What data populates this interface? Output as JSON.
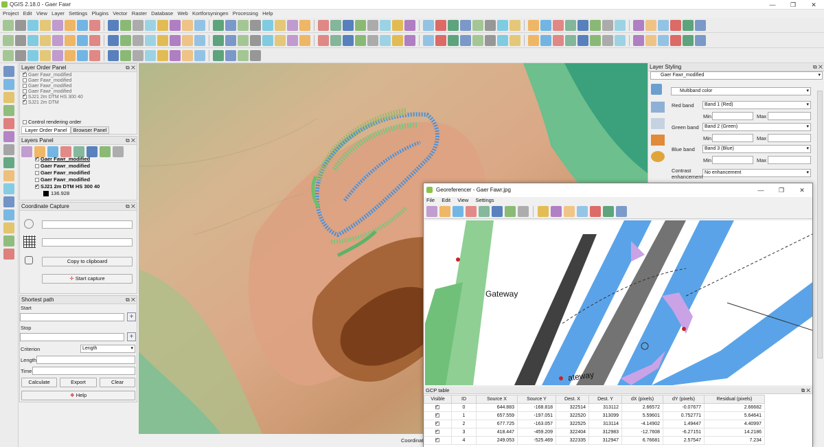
{
  "window": {
    "title": "QGIS 2.18.0 - Gaer Fawr",
    "min": "—",
    "max": "❐",
    "close": "✕"
  },
  "menu": [
    "Project",
    "Edit",
    "View",
    "Layer",
    "Settings",
    "Plugins",
    "Vector",
    "Raster",
    "Database",
    "Web",
    "Kortforsyningen",
    "Processing",
    "Help"
  ],
  "layer_order": {
    "title": "Layer Order Panel",
    "items": [
      "Gaer Fawr_modified",
      "Gaer Fawr_modified",
      "Gaer Fawr_modified",
      "Gaer Fawr_modified",
      "SJ21 2m DTM HS 300 40",
      "SJ21 2m DTM"
    ],
    "control_label": "Control rendering order",
    "tabs": [
      "Layer Order Panel",
      "Browser Panel"
    ]
  },
  "layers": {
    "title": "Layers Panel",
    "items": [
      "Gaer Fawr_modified",
      "Gaer Fawr_modified",
      "Gaer Fawr_modified",
      "Gaer Fawr_modified",
      "SJ21 2m DTM HS 300 40"
    ],
    "value": "136.928"
  },
  "coord_capture": {
    "title": "Coordinate Capture",
    "copy_label": "Copy to clipboard",
    "start_label": "Start capture"
  },
  "shortest_path": {
    "title": "Shortest path",
    "start_label": "Start",
    "stop_label": "Stop",
    "criterion_label": "Criterion",
    "criterion_value": "Length",
    "length_label": "Length",
    "time_label": "Time",
    "calculate": "Calculate",
    "export": "Export",
    "clear": "Clear",
    "help": "Help"
  },
  "layer_styling": {
    "title": "Layer Styling",
    "layer": "Gaer Fawr_modified",
    "renderer": "Multiband color",
    "red_band_label": "Red band",
    "red_band": "Band 1 (Red)",
    "green_band_label": "Green band",
    "green_band": "Band 2 (Green)",
    "blue_band_label": "Blue band",
    "blue_band": "Band 3 (Blue)",
    "min_label": "Min",
    "max_label": "Max",
    "contrast_label": "Contrast enhancement",
    "contrast": "No enhancement"
  },
  "georeferencer": {
    "title": "Georeferencer - Gaer Fawr.jpg",
    "menu": [
      "File",
      "Edit",
      "View",
      "Settings"
    ],
    "map_label_1": "Gateway",
    "map_label_2": "ateway"
  },
  "gcp": {
    "title": "GCP table",
    "headers": [
      "Visible",
      "ID",
      "Source X",
      "Source Y",
      "Dest. X",
      "Dest. Y",
      "dX (pixels)",
      "dY (pixels)",
      "Residual (pixels)"
    ],
    "rows": [
      [
        "0",
        "644.883",
        "-168.818",
        "322514",
        "313112",
        "2.66572",
        "-0.07677",
        "2.66682"
      ],
      [
        "1",
        "657.559",
        "-197.051",
        "322520",
        "313099",
        "5.59601",
        "0.752771",
        "5.64641"
      ],
      [
        "2",
        "677.725",
        "-163.057",
        "322525",
        "313114",
        "-4.14902",
        "1.49447",
        "4.40997"
      ],
      [
        "3",
        "418.447",
        "-459.209",
        "322404",
        "312983",
        "-12.7608",
        "-6.27151",
        "14.2186"
      ],
      [
        "4",
        "249.053",
        "-525.469",
        "322335",
        "312947",
        "6.76681",
        "2.57547",
        "7.234"
      ]
    ]
  },
  "status": {
    "coordinate_label": "Coordinate"
  },
  "colors": {
    "accent": "#3d6db5",
    "dtm_high": "#7a3f1a",
    "dtm_low": "#2fa07a",
    "hachure_blue": "#4a90d9",
    "hachure_green": "#7dc47d"
  }
}
